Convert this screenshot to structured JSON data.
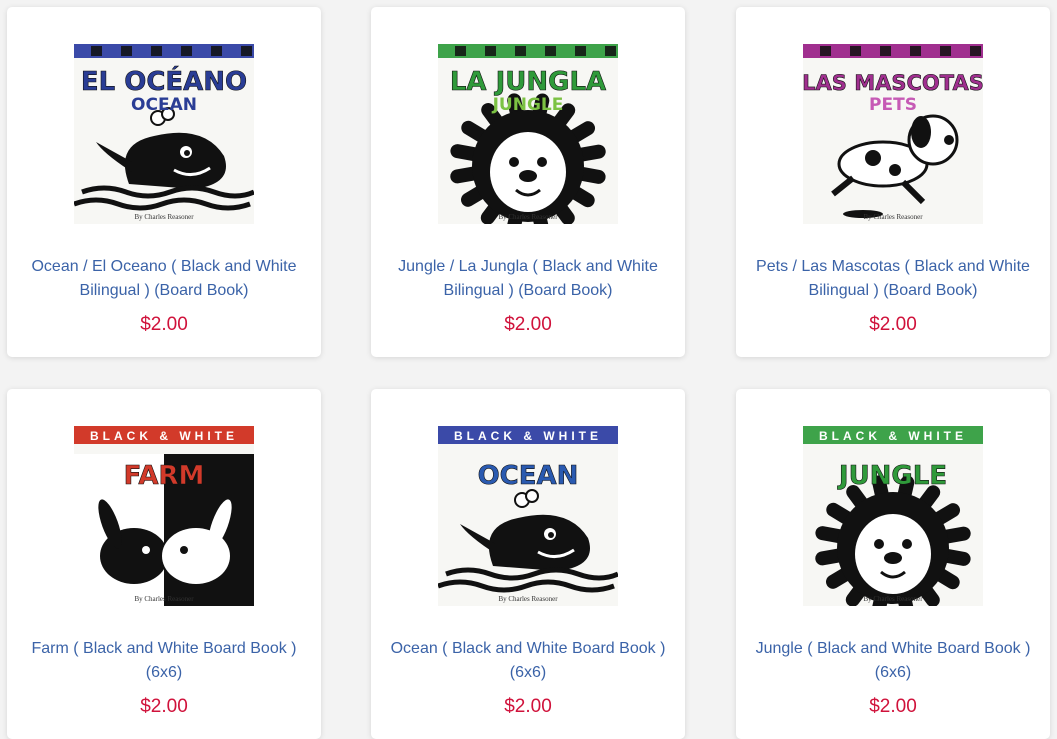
{
  "products": [
    {
      "title": "Ocean / El Oceano ( Black and White Bilingual ) (Board Book)",
      "price": "$2.00",
      "cover": {
        "strip_color": "#3b4aa8",
        "line1": "EL OCÉANO",
        "line2": "OCEAN",
        "line1_color": "#2a3d95",
        "line2_color": "#2a3d95",
        "byline": "By Charles Reasoner",
        "art": "whale"
      }
    },
    {
      "title": "Jungle / La Jungla ( Black and White Bilingual ) (Board Book)",
      "price": "$2.00",
      "cover": {
        "strip_color": "#3ea34a",
        "line1": "LA JUNGLA",
        "line2": "JUNGLE",
        "line1_color": "#2f9a3a",
        "line2_color": "#7cc243",
        "byline": "By Charles Reasoner",
        "art": "lion"
      }
    },
    {
      "title": "Pets / Las Mascotas ( Black and White Bilingual ) (Board Book)",
      "price": "$2.00",
      "cover": {
        "strip_color": "#a02f8f",
        "line1": "LAS MASCOTAS",
        "line2": "PETS",
        "line1_color": "#a02f8f",
        "line2_color": "#c65ab5",
        "byline": "By Charles Reasoner",
        "art": "dog"
      }
    },
    {
      "title": "Farm ( Black and White Board Book ) (6x6)",
      "price": "$2.00",
      "cover": {
        "strip_color": "#d23a2a",
        "series": "BLACK & WHITE",
        "line1": "FARM",
        "line1_color": "#d23a2a",
        "byline": "By Charles Reasoner",
        "art": "rabbits"
      }
    },
    {
      "title": "Ocean ( Black and White Board Book ) (6x6)",
      "price": "$2.00",
      "cover": {
        "strip_color": "#3b4aa8",
        "series": "BLACK & WHITE",
        "line1": "OCEAN",
        "line1_color": "#2a5ab0",
        "byline": "By Charles Reasoner",
        "art": "whale"
      }
    },
    {
      "title": "Jungle ( Black and White Board Book ) (6x6)",
      "price": "$2.00",
      "cover": {
        "strip_color": "#3ea34a",
        "series": "BLACK & WHITE",
        "line1": "JUNGLE",
        "line1_color": "#2f9a3a",
        "byline": "By Charles Reasoner",
        "art": "lion"
      }
    }
  ],
  "colors": {
    "title_link": "#3b63a8",
    "price": "#d0123b"
  }
}
